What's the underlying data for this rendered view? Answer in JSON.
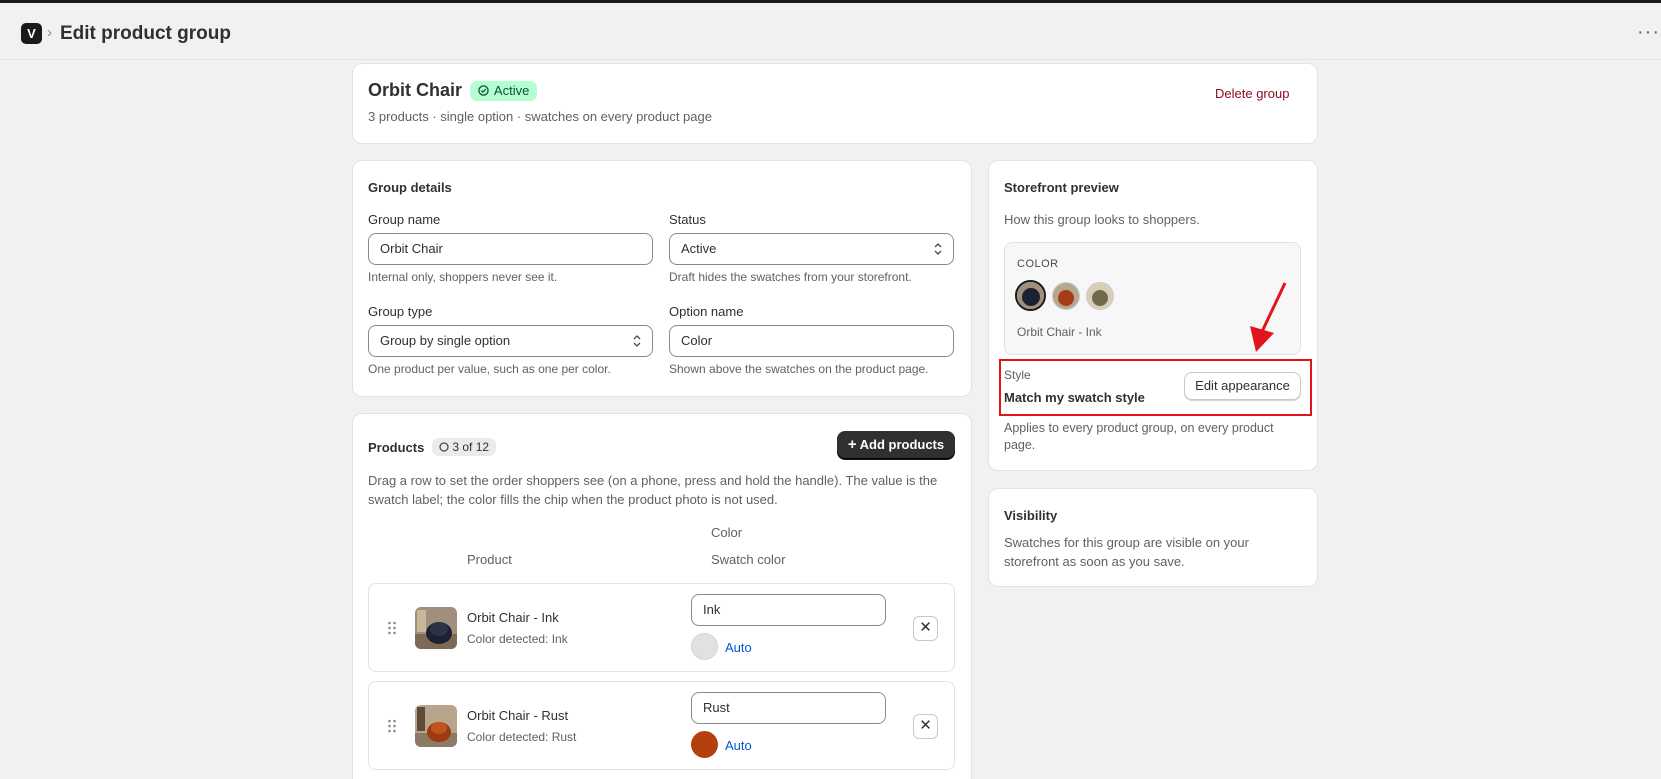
{
  "header": {
    "title": "Edit product group",
    "breadcrumb_sep": "›",
    "more": "···",
    "logo_letter": "V"
  },
  "summary": {
    "name": "Orbit Chair",
    "status_badge": "Active",
    "subtitle": "3 products · single option · swatches on every product page",
    "delete_label": "Delete group"
  },
  "details": {
    "title": "Group details",
    "group_name_label": "Group name",
    "group_name_value": "Orbit Chair",
    "group_name_help": "Internal only, shoppers never see it.",
    "status_label": "Status",
    "status_value": "Active",
    "status_help": "Draft hides the swatches from your storefront.",
    "group_type_label": "Group type",
    "group_type_value": "Group by single option",
    "group_type_help": "One product per value, such as one per color.",
    "option_name_label": "Option name",
    "option_name_value": "Color",
    "option_name_help": "Shown above the swatches on the product page."
  },
  "products": {
    "title": "Products",
    "count_badge": "3 of 12",
    "add_label": "Add products",
    "description": "Drag a row to set the order shoppers see (on a phone, press and hold the handle). The value is the swatch label; the color fills the chip when the product photo is not used.",
    "col_option": "Color",
    "col_product": "Product",
    "col_swatch": "Swatch color",
    "rows": [
      {
        "name": "Orbit Chair - Ink",
        "detected": "Color detected: Ink",
        "value": "Ink",
        "swatch_color": "#e1e1e1",
        "swatch_mode": "Auto"
      },
      {
        "name": "Orbit Chair - Rust",
        "detected": "Color detected: Rust",
        "value": "Rust",
        "swatch_color": "#b5400f",
        "swatch_mode": "Auto"
      }
    ]
  },
  "preview": {
    "title": "Storefront preview",
    "description": "How this group looks to shoppers.",
    "option_label": "COLOR",
    "selected_label": "Orbit Chair - Ink",
    "style_label": "Style",
    "style_value": "Match my swatch style",
    "edit_label": "Edit appearance",
    "applies_note": "Applies to every product group, on every product page."
  },
  "visibility": {
    "title": "Visibility",
    "description": "Swatches for this group are visible on your storefront as soon as you save."
  },
  "colors": {
    "accent_dark": "#303030",
    "active_bg": "#b4fed2",
    "danger": "#8e0b21",
    "link": "#005bd3",
    "annotation": "#e3131d"
  }
}
